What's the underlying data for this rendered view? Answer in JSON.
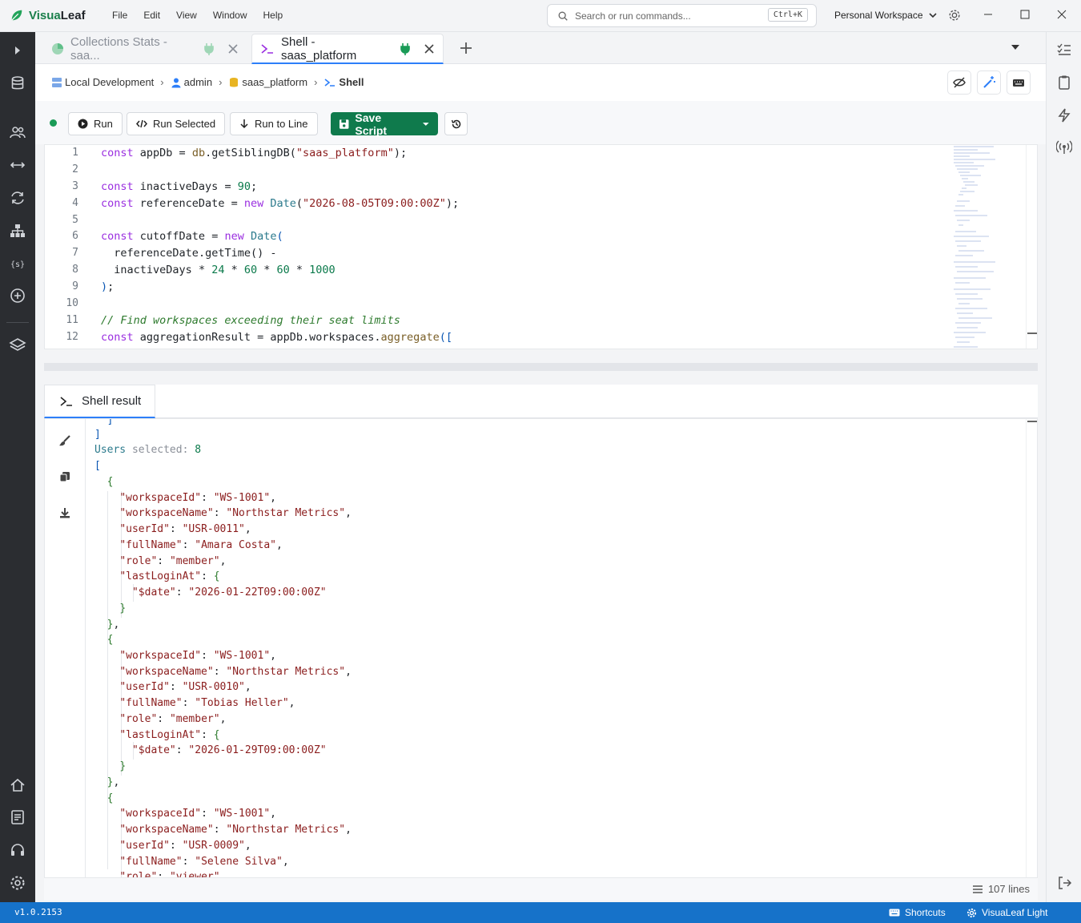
{
  "app": {
    "name_a": "Visua",
    "name_b": "Leaf",
    "version": "v1.0.2153"
  },
  "menu": [
    "File",
    "Edit",
    "View",
    "Window",
    "Help"
  ],
  "search": {
    "placeholder": "Search or run commands...",
    "shortcut": "Ctrl+K"
  },
  "workspace": {
    "label": "Personal Workspace"
  },
  "tabs": [
    {
      "label": "Collections Stats - saa...",
      "active": false
    },
    {
      "label": "Shell - saas_platform",
      "active": true
    }
  ],
  "breadcrumb": {
    "connection": "Local Development",
    "user": "admin",
    "database": "saas_platform",
    "view": "Shell"
  },
  "toolbar": {
    "run": "Run",
    "run_selected": "Run Selected",
    "run_to_line": "Run to Line",
    "save_script": "Save Script"
  },
  "editor": {
    "lines": [
      {
        "n": "1"
      },
      {
        "n": "2"
      },
      {
        "n": "3"
      },
      {
        "n": "4"
      },
      {
        "n": "5"
      },
      {
        "n": "6"
      },
      {
        "n": "7"
      },
      {
        "n": "8"
      },
      {
        "n": "9"
      },
      {
        "n": "10"
      },
      {
        "n": "11"
      },
      {
        "n": "12"
      }
    ],
    "t": {
      "const": "const",
      "appDb": "appDb",
      "db": "db",
      "getSiblingDB": "getSiblingDB",
      "dbname": "\"saas_platform\"",
      "inactiveDays": "inactiveDays",
      "n90": "90",
      "referenceDate": "referenceDate",
      "new": "new",
      "Date": "Date",
      "datestr": "\"2026-08-05T09:00:00Z\"",
      "cutoffDate": "cutoffDate",
      "getTime": "getTime",
      "n24": "24",
      "n60": "60",
      "n1000": "1000",
      "comment": "// Find workspaces exceeding their seat limits",
      "aggregationResult": "aggregationResult",
      "workspaces": "workspaces",
      "aggregate": "aggregate"
    }
  },
  "result": {
    "tab_label": "Shell result",
    "line_count": "107 lines",
    "users_label": "Users",
    "selected_label": "selected:",
    "selected_count": "8",
    "records": [
      {
        "workspaceId": "\"WS-1001\"",
        "workspaceName": "\"Northstar Metrics\"",
        "userId": "\"USR-0011\"",
        "fullName": "\"Amara Costa\"",
        "role": "\"member\"",
        "date": "\"2026-01-22T09:00:00Z\""
      },
      {
        "workspaceId": "\"WS-1001\"",
        "workspaceName": "\"Northstar Metrics\"",
        "userId": "\"USR-0010\"",
        "fullName": "\"Tobias Heller\"",
        "role": "\"member\"",
        "date": "\"2026-01-29T09:00:00Z\""
      },
      {
        "workspaceId": "\"WS-1001\"",
        "workspaceName": "\"Northstar Metrics\"",
        "userId": "\"USR-0009\"",
        "fullName": "\"Selene Silva\"",
        "role": "\"viewer\""
      }
    ],
    "keys": {
      "workspaceId": "\"workspaceId\"",
      "workspaceName": "\"workspaceName\"",
      "userId": "\"userId\"",
      "fullName": "\"fullName\"",
      "role": "\"role\"",
      "lastLoginAt": "\"lastLoginAt\"",
      "date": "\"$date\""
    }
  },
  "statusbar": {
    "shortcuts": "Shortcuts",
    "theme": "VisuaLeaf Light"
  },
  "colors": {
    "accent": "#2d7ff9",
    "brand": "#0f7a4c",
    "statusbar": "#1672c9",
    "nav": "#2b2d31"
  }
}
